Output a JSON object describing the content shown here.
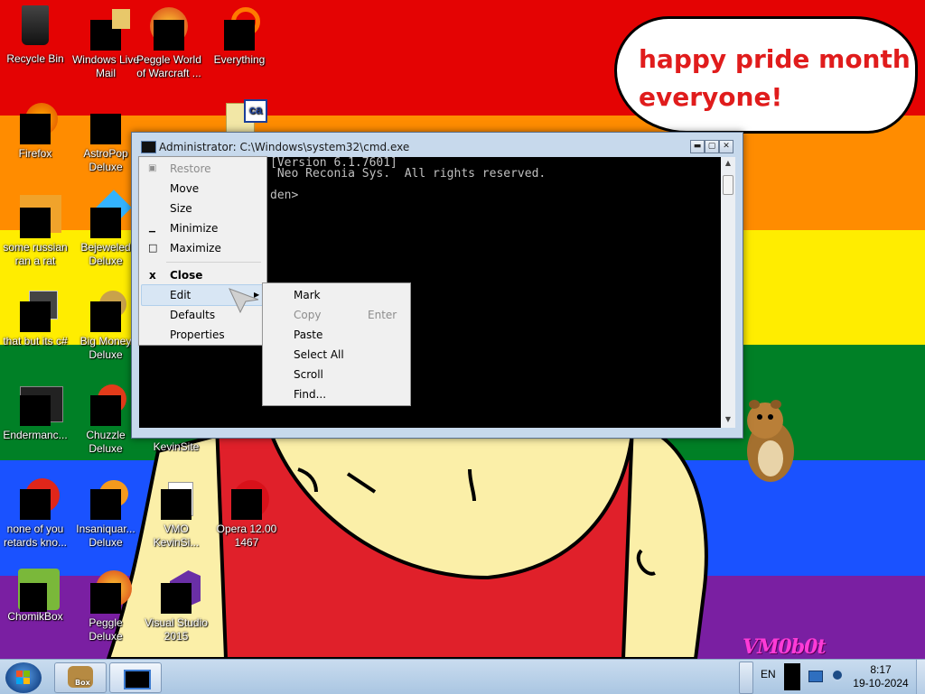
{
  "desktop": {
    "icons": [
      {
        "label": "Recycle Bin"
      },
      {
        "label": "Windows Live Mail"
      },
      {
        "label": "Peggle World of Warcraft ..."
      },
      {
        "label": "Everything"
      },
      {
        "label": "Firefox"
      },
      {
        "label": "AstroPop Deluxe"
      },
      {
        "label": "some russian ran a rat"
      },
      {
        "label": "Bejeweled Deluxe"
      },
      {
        "label": "that but its c#"
      },
      {
        "label": "Big Money Deluxe"
      },
      {
        "label": "Endermanc..."
      },
      {
        "label": "Chuzzle Deluxe"
      },
      {
        "label": "KevinSite"
      },
      {
        "label": "none of you retards kno..."
      },
      {
        "label": "Insaniquar... Deluxe"
      },
      {
        "label": "VMO KevinSi..."
      },
      {
        "label": "Opera 12.00 1467"
      },
      {
        "label": "ChomikBox"
      },
      {
        "label": "Peggle Deluxe"
      },
      {
        "label": "Visual Studio 2015"
      }
    ],
    "bubble_text": [
      "happy pride month",
      "everyone!"
    ],
    "watermark": "VM0b0t"
  },
  "cmd_window": {
    "title": "Administrator: C:\\Windows\\system32\\cmd.exe",
    "console_lines": [
      "[Version 6.1.7601]",
      " Neo Reconia Sys.  All rights reserved.",
      "",
      "den>"
    ],
    "buttons": {
      "minimize": "▬",
      "maximize": "▢",
      "close": "✕"
    }
  },
  "system_menu": {
    "items": [
      {
        "label": "Restore",
        "icon": "▣",
        "enabled": false
      },
      {
        "label": "Move",
        "icon": "",
        "enabled": true
      },
      {
        "label": "Size",
        "icon": "",
        "enabled": true
      },
      {
        "label": "Minimize",
        "icon": "▁",
        "enabled": true
      },
      {
        "label": "Maximize",
        "icon": "□",
        "enabled": true
      },
      {
        "label": "Close",
        "icon": "x",
        "enabled": true,
        "bold": true
      },
      {
        "label": "Edit",
        "icon": "",
        "enabled": true,
        "submenu": true,
        "highlighted": true
      },
      {
        "label": "Defaults",
        "icon": "",
        "enabled": true
      },
      {
        "label": "Properties",
        "icon": "",
        "enabled": true
      }
    ]
  },
  "edit_submenu": {
    "items": [
      {
        "label": "Mark",
        "shortcut": "",
        "enabled": true
      },
      {
        "label": "Copy",
        "shortcut": "Enter",
        "enabled": false
      },
      {
        "label": "Paste",
        "shortcut": "",
        "enabled": true
      },
      {
        "label": "Select All",
        "shortcut": "",
        "enabled": true
      },
      {
        "label": "Scroll",
        "shortcut": "",
        "enabled": true
      },
      {
        "label": "Find...",
        "shortcut": "",
        "enabled": true
      }
    ]
  },
  "taskbar": {
    "language": "EN",
    "time": "8:17",
    "date": "19-10-2024",
    "pinned": [
      {
        "name": "ChomikBox",
        "label": "Box"
      },
      {
        "name": "cmd"
      }
    ]
  },
  "colors": {
    "stripes": [
      "#e40303",
      "#ff8c00",
      "#ffed00",
      "#008026",
      "#1a52ff",
      "#7a1fa2"
    ],
    "bubble_text": "#e01c1c",
    "menu_bg": "#f0f0f0",
    "console_bg": "#000000",
    "console_fg": "#c0c0c0"
  }
}
